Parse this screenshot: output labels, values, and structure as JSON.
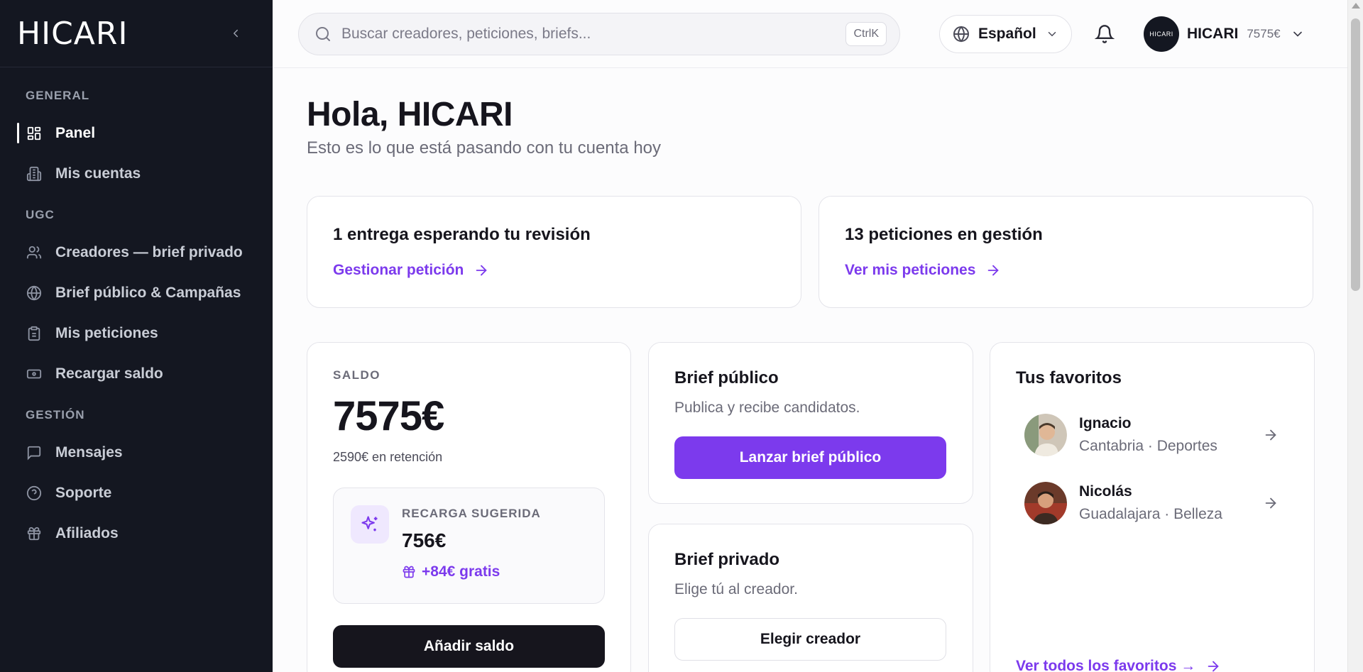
{
  "sidebar": {
    "logo": "HICARI",
    "sections": [
      {
        "label": "GENERAL",
        "items": [
          {
            "label": "Panel",
            "icon": "dashboard-icon",
            "active": true
          },
          {
            "label": "Mis cuentas",
            "icon": "building-icon"
          }
        ]
      },
      {
        "label": "UGC",
        "items": [
          {
            "label": "Creadores — brief privado",
            "icon": "users-icon"
          },
          {
            "label": "Brief público & Campañas",
            "icon": "globe-icon"
          },
          {
            "label": "Mis peticiones",
            "icon": "clipboard-icon"
          },
          {
            "label": "Recargar saldo",
            "icon": "banknote-icon"
          }
        ]
      },
      {
        "label": "GESTIÓN",
        "items": [
          {
            "label": "Mensajes",
            "icon": "message-icon"
          },
          {
            "label": "Soporte",
            "icon": "help-icon"
          },
          {
            "label": "Afiliados",
            "icon": "gift-icon"
          }
        ]
      }
    ]
  },
  "topbar": {
    "search_placeholder": "Buscar creadores, peticiones, briefs...",
    "search_value": "",
    "shortcut": "CtrlK",
    "language": "Español",
    "user_name": "HICARI",
    "user_avatar_text": "HICARI",
    "user_balance": "7575€"
  },
  "main": {
    "greeting": "Hola, HICARI",
    "subgreeting": "Esto es lo que está pasando con tu cuenta hoy",
    "alerts": [
      {
        "title": "1 entrega esperando tu revisión",
        "link": "Gestionar petición"
      },
      {
        "title": "13 peticiones en gestión",
        "link": "Ver mis peticiones"
      }
    ],
    "saldo": {
      "label": "SALDO",
      "amount": "7575€",
      "retention": "2590€ en retención",
      "suggest_label": "RECARGA SUGERIDA",
      "suggest_amount": "756€",
      "suggest_bonus": "+84€ gratis",
      "button": "Añadir saldo"
    },
    "brief_public": {
      "title": "Brief público",
      "desc": "Publica y recibe candidatos.",
      "button": "Lanzar brief público"
    },
    "brief_private": {
      "title": "Brief privado",
      "desc": "Elige tú al creador.",
      "button": "Elegir creador"
    },
    "favorites": {
      "title": "Tus favoritos",
      "items": [
        {
          "name": "Ignacio",
          "meta": "Cantabria · Deportes"
        },
        {
          "name": "Nicolás",
          "meta": "Guadalajara · Belleza"
        }
      ],
      "link": "Ver todos los favoritos →"
    }
  },
  "colors": {
    "accent": "#7c3aed",
    "sidebar_bg": "#141721",
    "dark_button": "#16151d"
  }
}
